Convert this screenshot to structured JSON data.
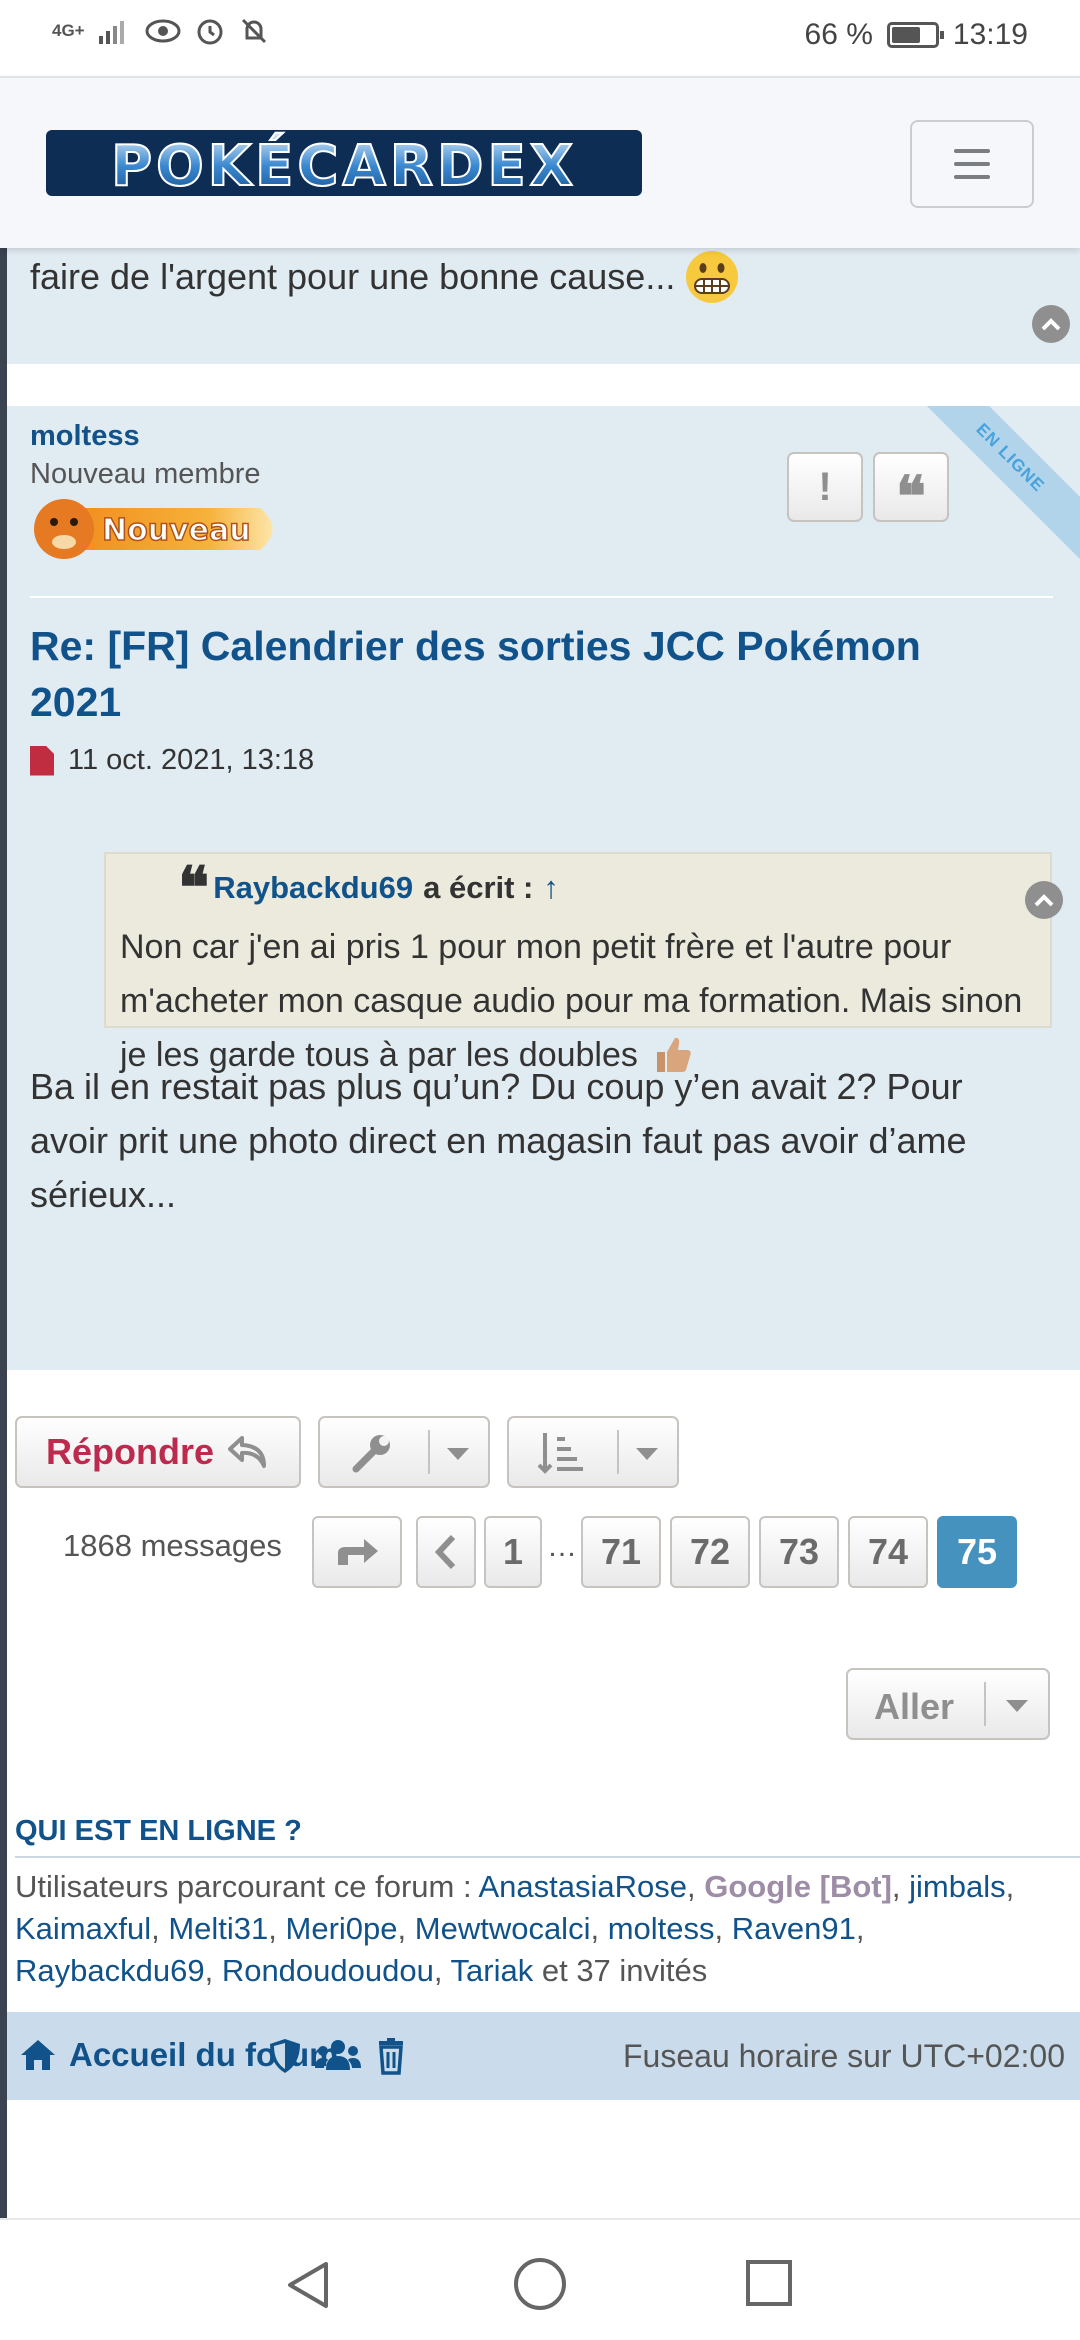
{
  "status_bar": {
    "network": "4G+",
    "battery": "66 %",
    "battery_level": 0.66,
    "time": "13:19"
  },
  "header": {
    "logo_text": "POKÉCARDEX",
    "menu_icon": "hamburger-icon"
  },
  "previous_post": {
    "text_tail": "faire de l'argent pour une bonne cause...",
    "emoji": "grimacing-face"
  },
  "post": {
    "author": "moltess",
    "rank": "Nouveau membre",
    "rank_badge": "Nouveau",
    "online_ribbon": "EN LIGNE",
    "title": "Re: [FR] Calendrier des sorties JCC Pokémon 2021",
    "date": "11 oct. 2021, 13:18",
    "quote": {
      "author": "Raybackdu69",
      "wrote": "a écrit :",
      "arrow": "↑",
      "text": "Non car j'en ai pris 1 pour mon petit frère et l'autre pour m'acheter mon casque audio pour ma formation. Mais sinon je les garde tous à par les doubles"
    },
    "body": "Ba il en restait pas plus qu’un? Du coup y’en avait 2? Pour avoir prit une photo direct en magasin faut pas avoir d’ame sérieux..."
  },
  "actions": {
    "reply_label": "Répondre"
  },
  "pagination": {
    "message_count": "1868 messages",
    "pages": [
      "1",
      "71",
      "72",
      "73",
      "74",
      "75"
    ],
    "ellipsis": "…",
    "active_page": "75"
  },
  "jump": {
    "label": "Aller"
  },
  "online": {
    "title": "QUI EST EN LIGNE ?",
    "prefix": "Utilisateurs parcourant ce forum : ",
    "users": [
      "AnastasiaRose",
      "Google [Bot]",
      "jimbals",
      "Kaimaxful",
      "Melti31",
      "Meri0pe",
      "Mewtwocalci",
      "moltess",
      "Raven91",
      "Raybackdu69",
      "Rondoudoudou",
      "Tariak"
    ],
    "suffix": " et 37 invités"
  },
  "footer": {
    "home_label": "Accueil du forum",
    "timezone": "Fuseau horaire sur UTC+02:00"
  },
  "colors": {
    "link_blue": "#105289",
    "post_bg": "#e1ebf2",
    "reply_red": "#bc2a4d",
    "active_page": "#4692bf",
    "footer_bg": "#cadceb"
  }
}
